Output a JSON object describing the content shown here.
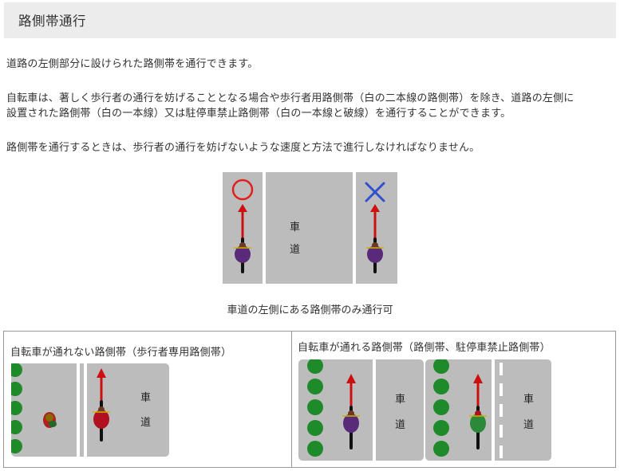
{
  "section": {
    "title": "路側帯通行"
  },
  "paragraphs": [
    "道路の左側部分に設けられた路側帯を通行できます。",
    "自転車は、著しく歩行者の通行を妨げることとなる場合や歩行者用路側帯（白の二本線の路側帯）を除き、道路の左側に",
    "設置された路側帯（白の一本線）又は駐停車禁止路側帯（白の一本線と破線）を通行することができます。",
    "路側帯を通行するときは、歩行者の通行を妨げないような速度と方法で進行しなければなりません。"
  ],
  "figure": {
    "road_label_1": "車",
    "road_label_2": "道",
    "allowed_mark": "○",
    "forbidden_mark": "×",
    "caption": "車道の左側にある路側帯のみ通行可"
  },
  "table": {
    "left_title": "自転車が通れない路側帯（歩行者専用路側帯）",
    "right_title": "自転車が通れる路側帯（路側帯、駐停車禁止路側帯）",
    "road_label_1": "車",
    "road_label_2": "道"
  },
  "colors": {
    "header_bg": "#ececec",
    "road": "#bcbcbc",
    "arrow": "#cc1010",
    "ok_circle": "#e02020",
    "ng_cross": "#3050d0",
    "rider": "#5a2a7a",
    "shrub": "#1f8a2a"
  }
}
